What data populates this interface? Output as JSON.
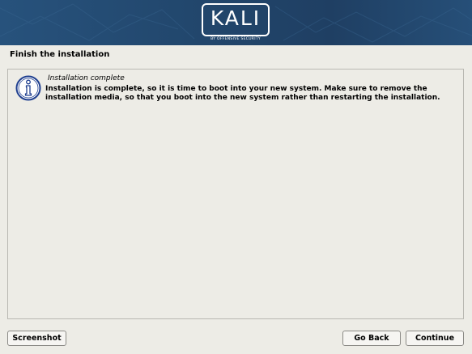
{
  "banner": {
    "logo_text": "KALI",
    "logo_subtext": "BY OFFENSIVE SECURITY"
  },
  "page": {
    "title": "Finish the installation"
  },
  "message": {
    "icon": "info-icon",
    "title": "Installation complete",
    "body": "Installation is complete, so it is time to boot into your new system. Make sure to remove the installation media, so that you boot into the new system rather than restarting the installation."
  },
  "buttons": {
    "screenshot": "Screenshot",
    "go_back": "Go Back",
    "continue": "Continue"
  },
  "colors": {
    "banner": "#22476d",
    "background": "#edece6",
    "info_icon": "#1f3f8f"
  }
}
